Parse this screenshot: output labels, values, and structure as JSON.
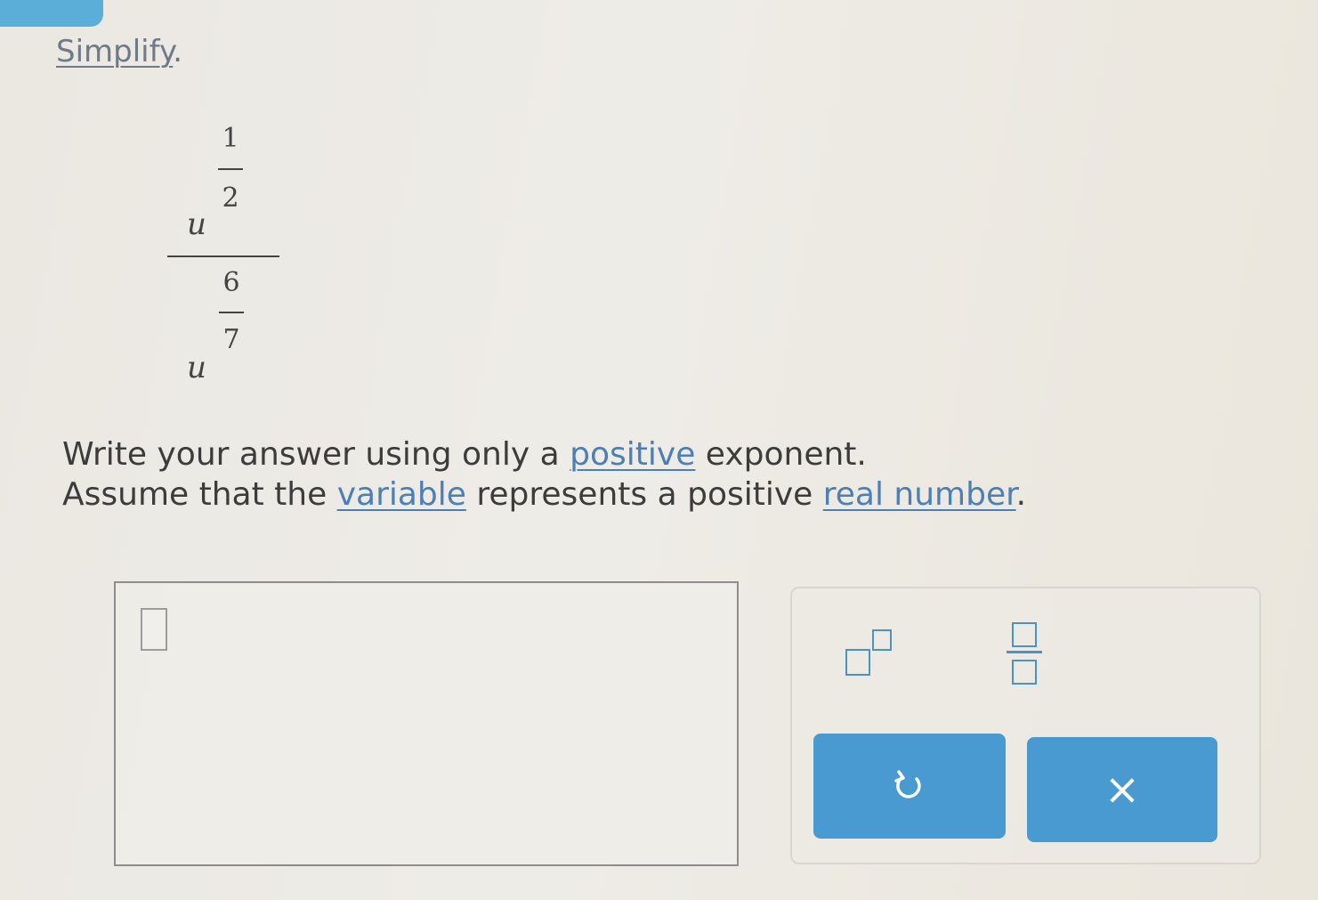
{
  "problem": {
    "prompt_link": "Simplify",
    "prompt_tail": ".",
    "numerator": {
      "base": "u",
      "exp_num": "1",
      "exp_den": "2"
    },
    "denominator": {
      "base": "u",
      "exp_num": "6",
      "exp_den": "7"
    },
    "line1": {
      "pre": "Write your answer using only a ",
      "link": "positive",
      "post": " exponent."
    },
    "line2": {
      "pre": "Assume that the ",
      "link1": "variable",
      "mid": " represents a positive ",
      "link2": "real number",
      "post": "."
    }
  },
  "keypad": {
    "exponent_tool": "superscript-template",
    "fraction_tool": "fraction-template",
    "undo_icon": "undo-icon",
    "clear_label": "×"
  },
  "colors": {
    "accent": "#4a9ad2",
    "link": "#4b7fb5",
    "tab": "#5aaed7"
  }
}
